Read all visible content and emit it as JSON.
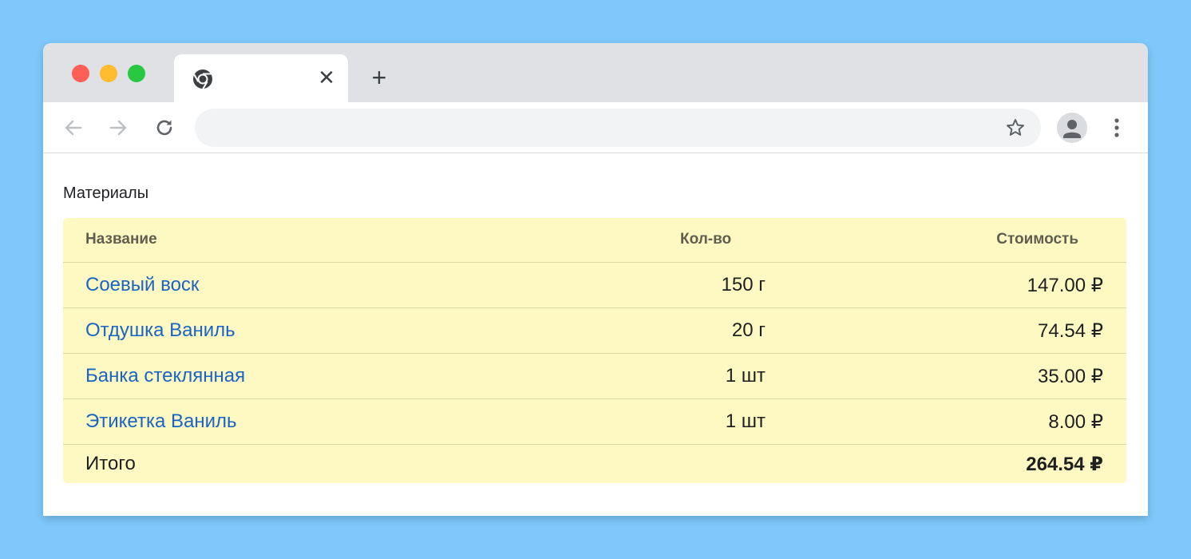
{
  "browser": {
    "tab_close_symbol": "✕",
    "new_tab_symbol": "+",
    "icons": [
      "chrome-icon",
      "back-arrow-icon",
      "forward-arrow-icon",
      "reload-icon",
      "star-icon",
      "account-icon",
      "more-vert-icon"
    ]
  },
  "page": {
    "section_title": "Материалы"
  },
  "table": {
    "headers": {
      "name": "Название",
      "qty": "Кол-во",
      "cost": "Стоимость"
    },
    "rows": [
      {
        "name": "Соевый воск",
        "qty": "150 г",
        "cost": "147.00 ₽"
      },
      {
        "name": "Отдушка Ваниль",
        "qty": "20 г",
        "cost": "74.54 ₽"
      },
      {
        "name": "Банка стеклянная",
        "qty": "1 шт",
        "cost": "35.00 ₽"
      },
      {
        "name": "Этикетка Ваниль",
        "qty": "1 шт",
        "cost": "8.00 ₽"
      }
    ],
    "total": {
      "label": "Итого",
      "value": "264.54 ₽"
    }
  },
  "colors": {
    "background": "#7ec8fb",
    "table_background": "#fef9c3",
    "link": "#1a64c4"
  }
}
